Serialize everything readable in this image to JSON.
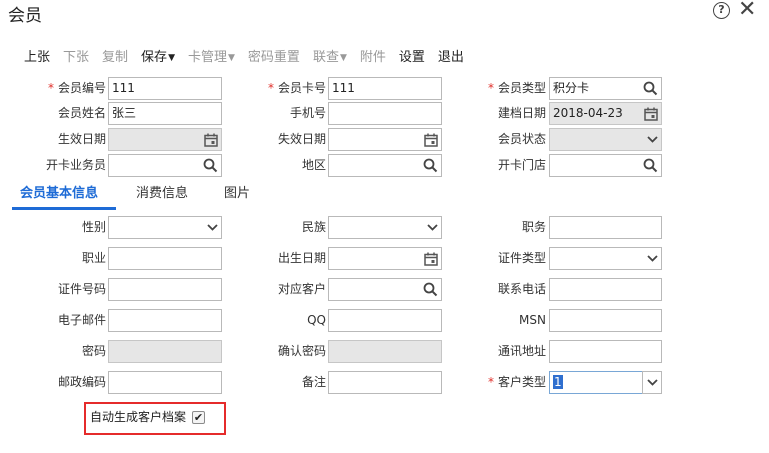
{
  "window": {
    "title": "会员"
  },
  "toolbar": {
    "buttons": [
      {
        "label": "上张",
        "enabled": true,
        "dropdown": false
      },
      {
        "label": "下张",
        "enabled": false,
        "dropdown": false
      },
      {
        "label": "复制",
        "enabled": false,
        "dropdown": false
      },
      {
        "label": "保存",
        "enabled": true,
        "dropdown": true
      },
      {
        "label": "卡管理",
        "enabled": false,
        "dropdown": true
      },
      {
        "label": "密码重置",
        "enabled": false,
        "dropdown": false
      },
      {
        "label": "联查",
        "enabled": false,
        "dropdown": true
      },
      {
        "label": "附件",
        "enabled": false,
        "dropdown": false
      },
      {
        "label": "设置",
        "enabled": true,
        "dropdown": false
      },
      {
        "label": "退出",
        "enabled": true,
        "dropdown": false
      }
    ]
  },
  "header_form": {
    "member_no": {
      "label": "会员编号",
      "value": "111",
      "required": true
    },
    "card_no": {
      "label": "会员卡号",
      "value": "111",
      "required": true
    },
    "member_type": {
      "label": "会员类型",
      "value": "积分卡",
      "required": true
    },
    "member_name": {
      "label": "会员姓名",
      "value": "张三"
    },
    "mobile": {
      "label": "手机号",
      "value": ""
    },
    "created_date": {
      "label": "建档日期",
      "value": "2018-04-23"
    },
    "effective_date": {
      "label": "生效日期",
      "value": ""
    },
    "expire_date": {
      "label": "失效日期",
      "value": ""
    },
    "member_status": {
      "label": "会员状态",
      "value": ""
    },
    "card_clerk": {
      "label": "开卡业务员",
      "value": ""
    },
    "region": {
      "label": "地区",
      "value": ""
    },
    "card_store": {
      "label": "开卡门店",
      "value": ""
    }
  },
  "tabs": [
    {
      "label": "会员基本信息",
      "active": true
    },
    {
      "label": "消费信息",
      "active": false
    },
    {
      "label": "图片",
      "active": false
    }
  ],
  "basic_form": {
    "gender": {
      "label": "性别",
      "value": ""
    },
    "ethnicity": {
      "label": "民族",
      "value": ""
    },
    "position": {
      "label": "职务",
      "value": ""
    },
    "occupation": {
      "label": "职业",
      "value": ""
    },
    "birth_date": {
      "label": "出生日期",
      "value": ""
    },
    "id_type": {
      "label": "证件类型",
      "value": ""
    },
    "id_no": {
      "label": "证件号码",
      "value": ""
    },
    "customer": {
      "label": "对应客户",
      "value": ""
    },
    "phone": {
      "label": "联系电话",
      "value": ""
    },
    "email": {
      "label": "电子邮件",
      "value": ""
    },
    "qq": {
      "label": "QQ",
      "value": ""
    },
    "msn": {
      "label": "MSN",
      "value": ""
    },
    "password": {
      "label": "密码",
      "value": ""
    },
    "confirm_password": {
      "label": "确认密码",
      "value": ""
    },
    "address": {
      "label": "通讯地址",
      "value": ""
    },
    "postcode": {
      "label": "邮政编码",
      "value": ""
    },
    "remark": {
      "label": "备注",
      "value": ""
    },
    "customer_type": {
      "label": "客户类型",
      "value": "1",
      "required": true
    }
  },
  "auto_archive": {
    "label": "自动生成客户档案",
    "checked": true,
    "check_mark": "✔"
  },
  "icons": {
    "help": "?",
    "close": "✕"
  },
  "colors": {
    "accent": "#1e6bd6",
    "required": "#e0302b",
    "highlight_box": "#e52b2b"
  }
}
